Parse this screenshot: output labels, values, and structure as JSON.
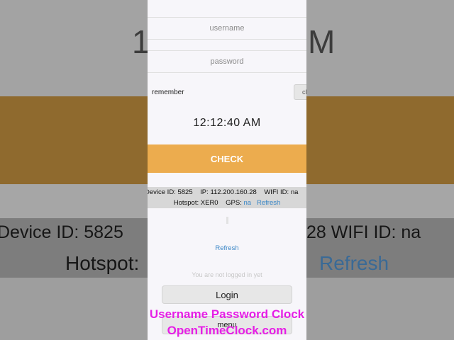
{
  "login_form": {
    "username_placeholder": "username",
    "password_placeholder": "password",
    "remember_label": "remember",
    "small_button_label": "cl"
  },
  "clock": {
    "time": "12:12:40 AM"
  },
  "check_button": {
    "label": "CHECK"
  },
  "device_info": {
    "device_id_label": "Device ID:",
    "device_id": "5825",
    "ip_label": "IP:",
    "ip": "112.200.160.28",
    "wifi_label": "WIFI ID:",
    "wifi_value": "na",
    "hotspot_label": "Hotspot:",
    "hotspot": "XER0",
    "gps_label": "GPS:",
    "gps_value": "na",
    "refresh_label": "Refresh"
  },
  "status": {
    "refresh_link": "Refresh",
    "not_logged_in": "You are not logged in yet"
  },
  "buttons": {
    "login": "Login",
    "menu": "menu"
  },
  "background_zoom": {
    "time_left": "1",
    "time_right": "M",
    "device_left": "Device ID:  5825",
    "device_right": "28    WIFI ID:  na",
    "hotspot_left": "Hotspot:",
    "refresh_right": "Refresh"
  },
  "caption": {
    "line1": "Username Password Clock",
    "line2": "OpenTimeClock.com"
  },
  "colors": {
    "accent_orange": "#ecac4e",
    "link_blue": "#3a86c6",
    "caption_magenta": "#e61ee6"
  }
}
